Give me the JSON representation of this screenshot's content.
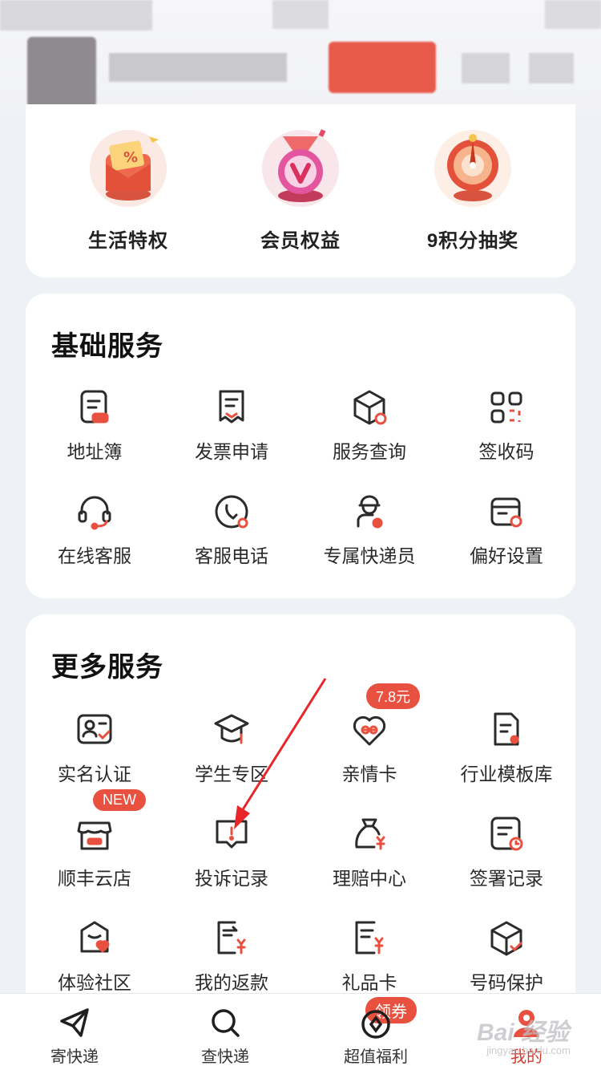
{
  "privileges": [
    {
      "label": "生活特权",
      "icon": "envelope-coupon-icon"
    },
    {
      "label": "会员权益",
      "icon": "medal-v-icon"
    },
    {
      "label": "9积分抽奖",
      "icon": "lottery-wheel-icon"
    }
  ],
  "basic": {
    "title": "基础服务",
    "items": [
      {
        "label": "地址簿",
        "icon": "address-book-icon"
      },
      {
        "label": "发票申请",
        "icon": "invoice-icon"
      },
      {
        "label": "服务查询",
        "icon": "package-search-icon"
      },
      {
        "label": "签收码",
        "icon": "qr-code-icon"
      },
      {
        "label": "在线客服",
        "icon": "headset-icon"
      },
      {
        "label": "客服电话",
        "icon": "phone-icon"
      },
      {
        "label": "专属快递员",
        "icon": "courier-icon"
      },
      {
        "label": "偏好设置",
        "icon": "settings-card-icon"
      }
    ]
  },
  "more": {
    "title": "更多服务",
    "items": [
      {
        "label": "实名认证",
        "icon": "id-card-icon"
      },
      {
        "label": "学生专区",
        "icon": "graduation-cap-icon"
      },
      {
        "label": "亲情卡",
        "icon": "heart-link-icon",
        "badge": "7.8元"
      },
      {
        "label": "行业模板库",
        "icon": "template-doc-icon"
      },
      {
        "label": "顺丰云店",
        "icon": "store-icon",
        "badge": "NEW"
      },
      {
        "label": "投诉记录",
        "icon": "complaint-icon"
      },
      {
        "label": "理赔中心",
        "icon": "money-bag-icon"
      },
      {
        "label": "签署记录",
        "icon": "signed-doc-icon"
      },
      {
        "label": "体验社区",
        "icon": "community-heart-icon"
      },
      {
        "label": "我的返款",
        "icon": "refund-icon"
      },
      {
        "label": "礼品卡",
        "icon": "gift-card-icon"
      },
      {
        "label": "号码保护",
        "icon": "shield-check-icon"
      }
    ]
  },
  "bottom_nav": {
    "items": [
      {
        "label": "寄快递",
        "icon": "send-plane-icon"
      },
      {
        "label": "查快递",
        "icon": "search-icon"
      },
      {
        "label": "超值福利",
        "icon": "coupon-icon",
        "badge": "领券"
      },
      {
        "label": "我的",
        "icon": "profile-icon"
      }
    ]
  },
  "watermark": {
    "text": "Bai 经验",
    "sub": "jingyan.baidu.com"
  },
  "colors": {
    "accent": "#e8513f",
    "icon_stroke": "#2b2b2b"
  }
}
